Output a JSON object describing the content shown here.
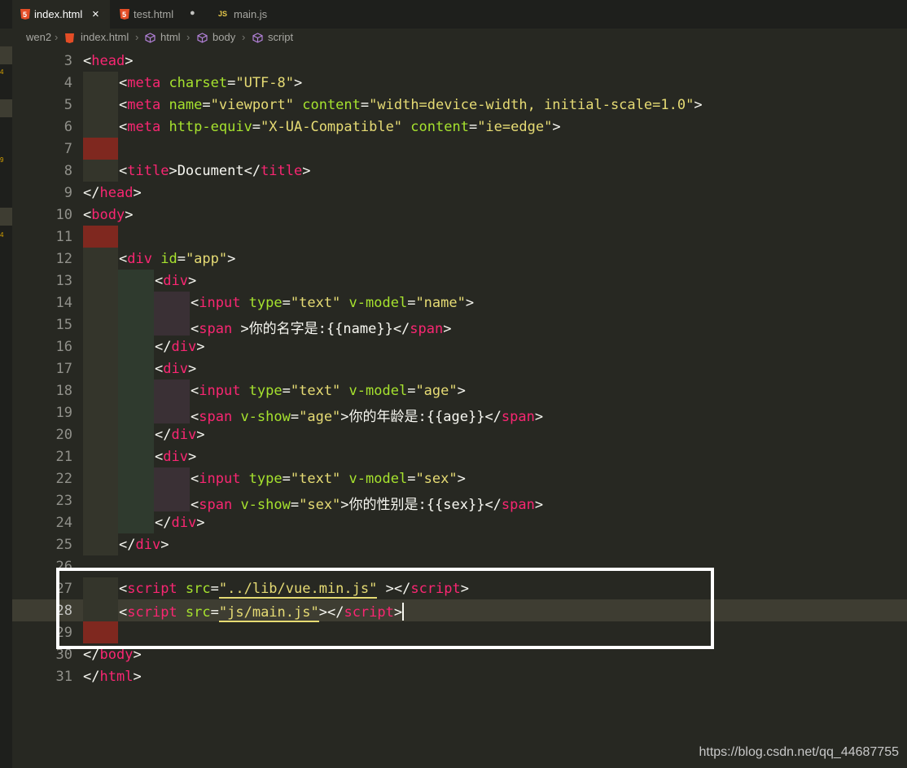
{
  "tabs": [
    {
      "label": "index.html",
      "icon": "html5-icon",
      "active": true,
      "state": "close"
    },
    {
      "label": "test.html",
      "icon": "html5-icon",
      "active": false,
      "state": "dirty"
    },
    {
      "label": "main.js",
      "icon": "js-icon",
      "active": false,
      "state": "none"
    }
  ],
  "tab_icon_glyphs": {
    "html": "5",
    "js": "JS",
    "close": "×",
    "dirty": "●"
  },
  "breadcrumb": {
    "items": [
      "wen2",
      "index.html",
      "html",
      "body",
      "script"
    ],
    "separator": "›"
  },
  "line_numbers": [
    "3",
    "4",
    "5",
    "6",
    "7",
    "8",
    "9",
    "10",
    "11",
    "12",
    "13",
    "14",
    "15",
    "16",
    "17",
    "18",
    "19",
    "20",
    "21",
    "22",
    "23",
    "24",
    "25",
    "26",
    "27",
    "28",
    "29",
    "30",
    "31"
  ],
  "code": {
    "l3": [
      "<",
      "head",
      ">"
    ],
    "l4": [
      "<",
      "meta",
      " charset",
      "=",
      "\"UTF-8\"",
      ">"
    ],
    "l5": [
      "<",
      "meta",
      " name",
      "=",
      "\"viewport\"",
      " content",
      "=",
      "\"width=device-width, initial-scale=1.0\"",
      ">"
    ],
    "l6": [
      "<",
      "meta",
      " http-equiv",
      "=",
      "\"X-UA-Compatible\"",
      " content",
      "=",
      "\"ie=edge\"",
      ">"
    ],
    "l8": [
      "<",
      "title",
      ">",
      "Document",
      "</",
      "title",
      ">"
    ],
    "l9": [
      "</",
      "head",
      ">"
    ],
    "l10": [
      "<",
      "body",
      ">"
    ],
    "l12": [
      "<",
      "div",
      " id",
      "=",
      "\"app\"",
      ">"
    ],
    "l13": [
      "<",
      "div",
      ">"
    ],
    "l14": [
      "<",
      "input",
      " type",
      "=",
      "\"text\"",
      " v-model",
      "=",
      "\"name\"",
      ">"
    ],
    "l15": [
      "<",
      "span",
      " >",
      "你的名字是:{{name}}",
      "</",
      "span",
      ">"
    ],
    "l16": [
      "</",
      "div",
      ">"
    ],
    "l17": [
      "<",
      "div",
      ">"
    ],
    "l18": [
      "<",
      "input",
      " type",
      "=",
      "\"text\"",
      " v-model",
      "=",
      "\"age\"",
      ">"
    ],
    "l19": [
      "<",
      "span",
      " v-show",
      "=",
      "\"age\"",
      ">",
      "你的年龄是:{{age}}",
      "</",
      "span",
      ">"
    ],
    "l20": [
      "</",
      "div",
      ">"
    ],
    "l21": [
      "<",
      "div",
      ">"
    ],
    "l22": [
      "<",
      "input",
      " type",
      "=",
      "\"text\"",
      " v-model",
      "=",
      "\"sex\"",
      ">"
    ],
    "l23": [
      "<",
      "span",
      " v-show",
      "=",
      "\"sex\"",
      ">",
      "你的性别是:{{sex}}",
      "</",
      "span",
      ">"
    ],
    "l24": [
      "</",
      "div",
      ">"
    ],
    "l25": [
      "</",
      "div",
      ">"
    ],
    "l27": [
      "<",
      "script",
      " src",
      "=",
      "\"",
      "../lib/vue.min.js",
      "\"",
      " ></",
      "script",
      ">"
    ],
    "l28": [
      "<",
      "script",
      " src",
      "=",
      "\"",
      "js/main.js",
      "\"",
      "></",
      "script",
      ">"
    ],
    "l30": [
      "</",
      "body",
      ">"
    ],
    "l31": [
      "</",
      "html",
      ">"
    ]
  },
  "watermark": "https://blog.csdn.net/qq_44687755",
  "colors": {
    "editor_bg": "#272822",
    "tag": "#f92672",
    "attr": "#a6e22e",
    "string": "#e6db74",
    "punct": "#f8f8f2",
    "highlight_border": "#ffffff",
    "error_gutter": "#7f281f"
  }
}
